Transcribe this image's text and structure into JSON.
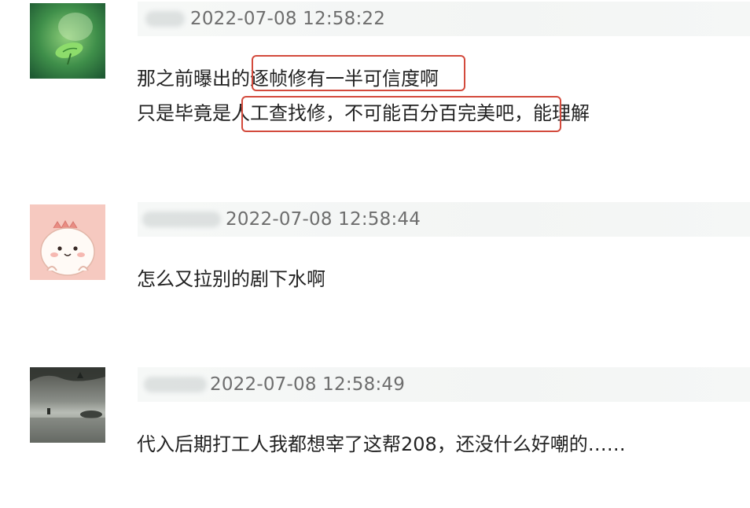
{
  "comments": [
    {
      "avatar_icon": "green-leaf-avatar",
      "username": "",
      "timestamp": "2022-07-08 12:58:22",
      "lines": [
        "那之前曝出的逐帧修有一半可信度啊",
        "只是毕竟是人工查找修，不可能百分百完美吧，能理解"
      ]
    },
    {
      "avatar_icon": "cartoon-dinosaur-avatar",
      "username": "",
      "timestamp": "2022-07-08 12:58:44",
      "lines": [
        "怎么又拉别的剧下水啊"
      ]
    },
    {
      "avatar_icon": "misty-landscape-avatar",
      "username": "",
      "timestamp": "2022-07-08 12:58:49",
      "lines": [
        "代入后期打工人我都想宰了这帮208，还没什么好嘲的……"
      ]
    }
  ],
  "colors": {
    "highlight_border": "#d34a3c",
    "timestamp_text": "#6e6e6e",
    "meta_bar_bg": "#f4f6f5"
  }
}
